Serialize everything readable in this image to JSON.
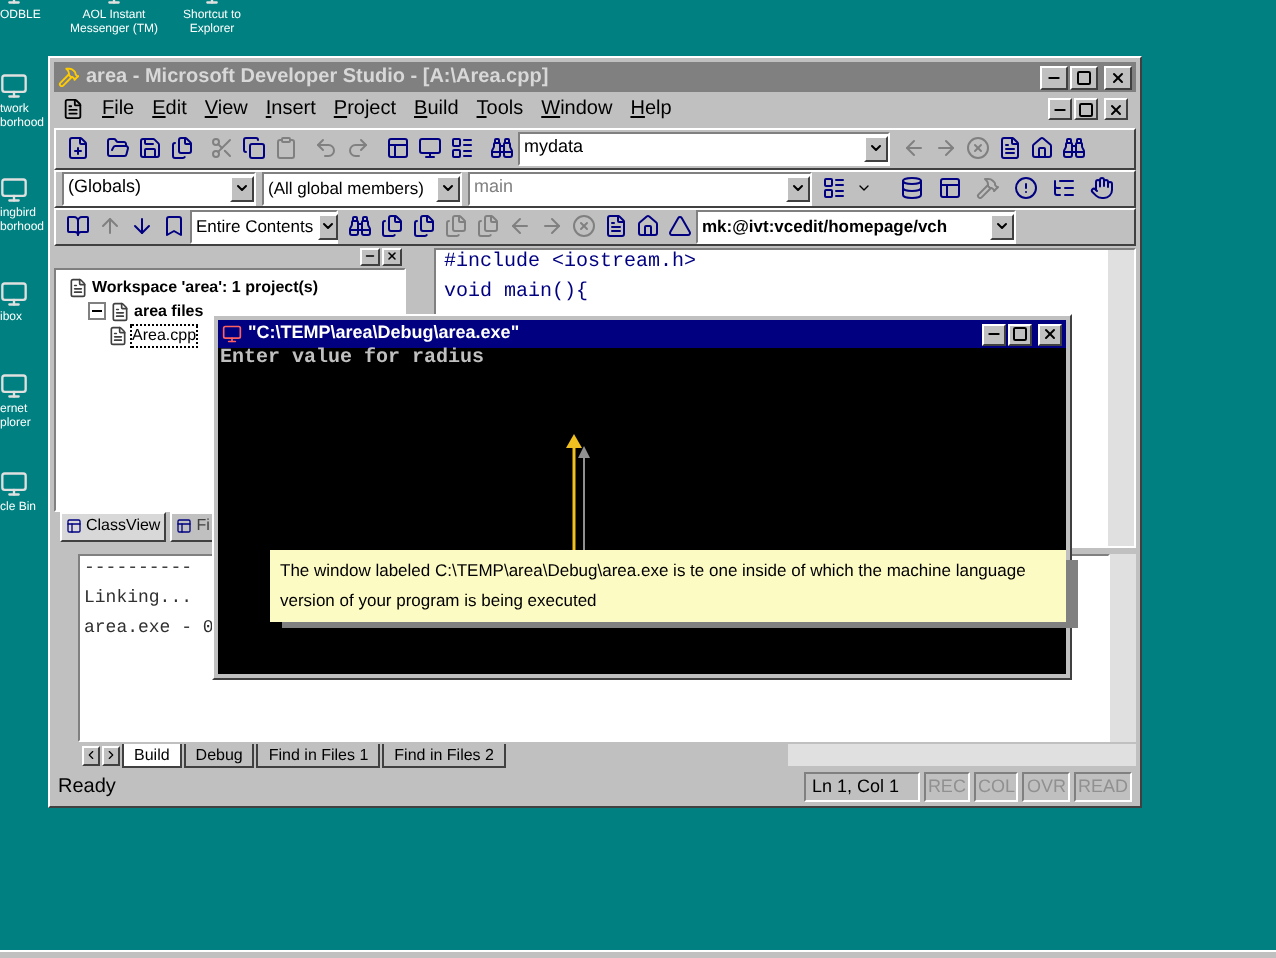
{
  "desktop_icons": [
    {
      "label": "ODBLE"
    },
    {
      "label": "AOL Instant Messenger (TM)"
    },
    {
      "label": "Shortcut to Explorer"
    },
    {
      "label": "twork borhood"
    },
    {
      "label": "ingbird borhood"
    },
    {
      "label": "ibox"
    },
    {
      "label": "ernet plorer"
    },
    {
      "label": "cle Bin"
    }
  ],
  "window": {
    "title": "area - Microsoft Developer Studio - [A:\\Area.cpp]",
    "active": false
  },
  "menu": [
    "File",
    "Edit",
    "View",
    "Insert",
    "Project",
    "Build",
    "Tools",
    "Window",
    "Help"
  ],
  "toolbar": {
    "find_combo": "mydata"
  },
  "wizard_bar": {
    "scope": "(Globals)",
    "members": "(All global members)",
    "function": "main"
  },
  "browse_toolbar": {
    "search_scope": "Entire Contents",
    "url": "mk:@ivt:vcedit/homepage/vch"
  },
  "workspace": {
    "tree": [
      {
        "label": "Workspace 'area': 1 project(s)",
        "children": [
          {
            "label": "area files",
            "expanded": true,
            "children": [
              {
                "label": "Area.cpp",
                "selected": true
              }
            ]
          }
        ]
      }
    ],
    "tabs": [
      {
        "label": "ClassView",
        "selected": true
      },
      {
        "label": "Fi",
        "selected": false
      }
    ]
  },
  "editor": {
    "lines": [
      "#include <iostream.h>",
      "void main(){"
    ]
  },
  "output": {
    "lines": [
      "----------",
      "Linking...",
      "area.exe - 0"
    ],
    "tabs": [
      {
        "label": "Build",
        "selected": true
      },
      {
        "label": "Debug",
        "selected": false
      },
      {
        "label": "Find in Files 1",
        "selected": false
      },
      {
        "label": "Find in Files 2",
        "selected": false
      }
    ]
  },
  "status_bar": {
    "message": "Ready",
    "position": "Ln 1, Col 1",
    "indicators": [
      {
        "label": "REC",
        "on": false
      },
      {
        "label": "COL",
        "on": false
      },
      {
        "label": "OVR",
        "on": false
      },
      {
        "label": "READ",
        "on": false
      }
    ]
  },
  "console": {
    "title": "\"C:\\TEMP\\area\\Debug\\area.exe\"",
    "active": true,
    "lines": [
      "Enter value for radius"
    ]
  },
  "callout": {
    "text": "The window labeled C:\\TEMP\\area\\Debug\\area.exe is te one inside of which the machine language version of your program is being executed"
  }
}
